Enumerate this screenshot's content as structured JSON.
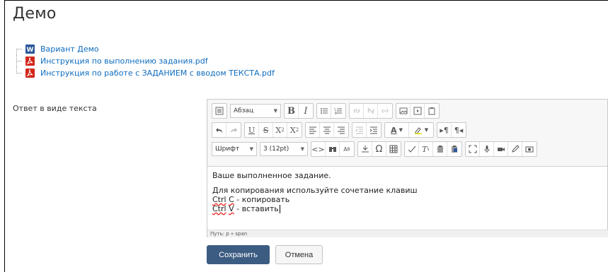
{
  "page": {
    "title": "Демо"
  },
  "files": [
    {
      "name": "Вариант Демо",
      "icon": "word-doc-icon"
    },
    {
      "name": "Инструкция по выполнению задания.pdf",
      "icon": "pdf-icon"
    },
    {
      "name": "Инструкция по работе с ЗАДАНИЕМ с вводом ТЕКСТА.pdf",
      "icon": "pdf-icon"
    }
  ],
  "answer": {
    "label": "Ответ в виде текста"
  },
  "editor": {
    "paragraph_select": "Абзац",
    "font_select": "Шрифт",
    "size_select": "3 (12pt)",
    "content": {
      "line1": "Ваше выполненное задание.",
      "line2": "Для копирования используйте сочетание клавиш",
      "line3_key": "Ctrl",
      "line3_letter": "C",
      "line3_rest": " - копировать",
      "line4_key": "Ctrl",
      "line4_letter": "V",
      "line4_rest": " - вставить"
    },
    "path": "Путь: p » span"
  },
  "buttons": {
    "save": "Сохранить",
    "cancel": "Отмена"
  },
  "colors": {
    "link": "#0f6cbf",
    "primary": "#3c5c82",
    "pdf": "#d2271b",
    "word": "#2b579a"
  }
}
